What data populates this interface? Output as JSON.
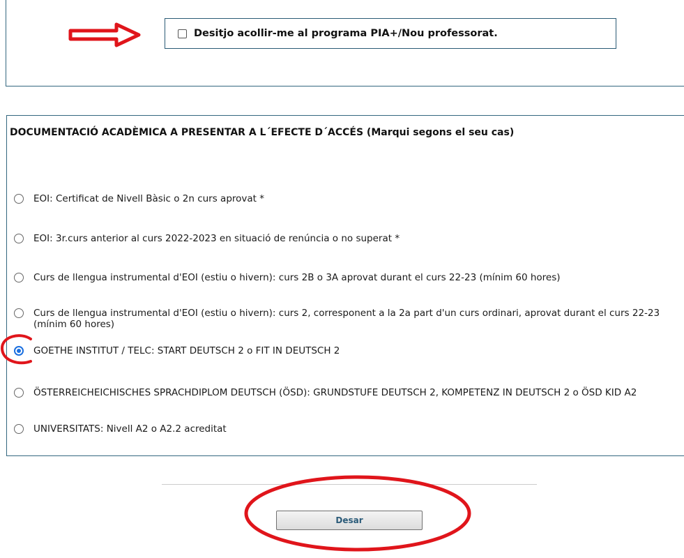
{
  "pia": {
    "checked": false,
    "label": "Desitjo acollir-me al programa PIA+/Nou professorat."
  },
  "documentation": {
    "title": "DOCUMENTACIÓ ACADÈMICA A PRESENTAR A L´EFECTE D´ACCÉS (Marqui segons el seu cas)",
    "options": [
      {
        "label": "EOI: Certificat de Nivell Bàsic o 2n curs aprovat *",
        "checked": false
      },
      {
        "label": "EOI: 3r.curs anterior al curs 2022-2023 en situació de renúncia o no superat *",
        "checked": false
      },
      {
        "label": "Curs de llengua instrumental d'EOI (estiu o hivern): curs 2B o 3A aprovat durant el curs 22-23 (mínim 60 hores)",
        "checked": false
      },
      {
        "label": "Curs de llengua instrumental d'EOI (estiu o hivern): curs 2, corresponent a la 2a part d'un curs ordinari, aprovat durant el curs 22-23 (mínim 60 hores)",
        "checked": false
      },
      {
        "label": "GOETHE INSTITUT / TELC: START DEUTSCH 2 o FIT IN DEUTSCH 2",
        "checked": true
      },
      {
        "label": "ÖSTERREICHEICHISCHES SPRACHDIPLOM DEUTSCH (ÖSD): GRUNDSTUFE DEUTSCH 2, KOMPETENZ IN DEUTSCH 2 o ÖSD KID A2",
        "checked": false
      },
      {
        "label": "UNIVERSITATS: Nivell A2 o A2.2 acreditat",
        "checked": false
      }
    ]
  },
  "actions": {
    "save_label": "Desar"
  },
  "annotation_colors": {
    "highlight": "#e0151b",
    "border": "#33677f",
    "radio_selected": "#1a6fe0"
  }
}
